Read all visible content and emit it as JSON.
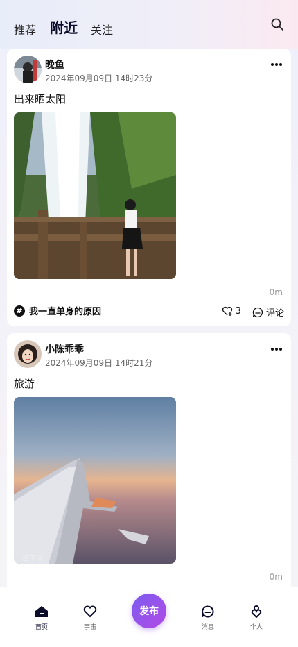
{
  "header": {
    "tabs": [
      {
        "label": "推荐",
        "active": false
      },
      {
        "label": "附近",
        "active": true
      },
      {
        "label": "关注",
        "active": false
      }
    ]
  },
  "posts": [
    {
      "username": "晚鱼",
      "time": "2024年09月09日 14时23分",
      "content": "出来晒太阳",
      "distance": "0m",
      "topic": "我一直单身的原因",
      "likes": "3",
      "comment_label": "评论"
    },
    {
      "username": "小陈乖乖",
      "time": "2024年09月09日 14时21分",
      "content": "旅游",
      "distance": "0m",
      "image_watermark": "日下涂"
    }
  ],
  "nav": {
    "home": "首页",
    "universe": "宇宙",
    "publish": "发布",
    "messages": "消息",
    "profile": "个人"
  },
  "colors": {
    "accent_from": "#7b5cf0",
    "accent_to": "#b24be6",
    "nav_active": "#0b0b2a"
  }
}
